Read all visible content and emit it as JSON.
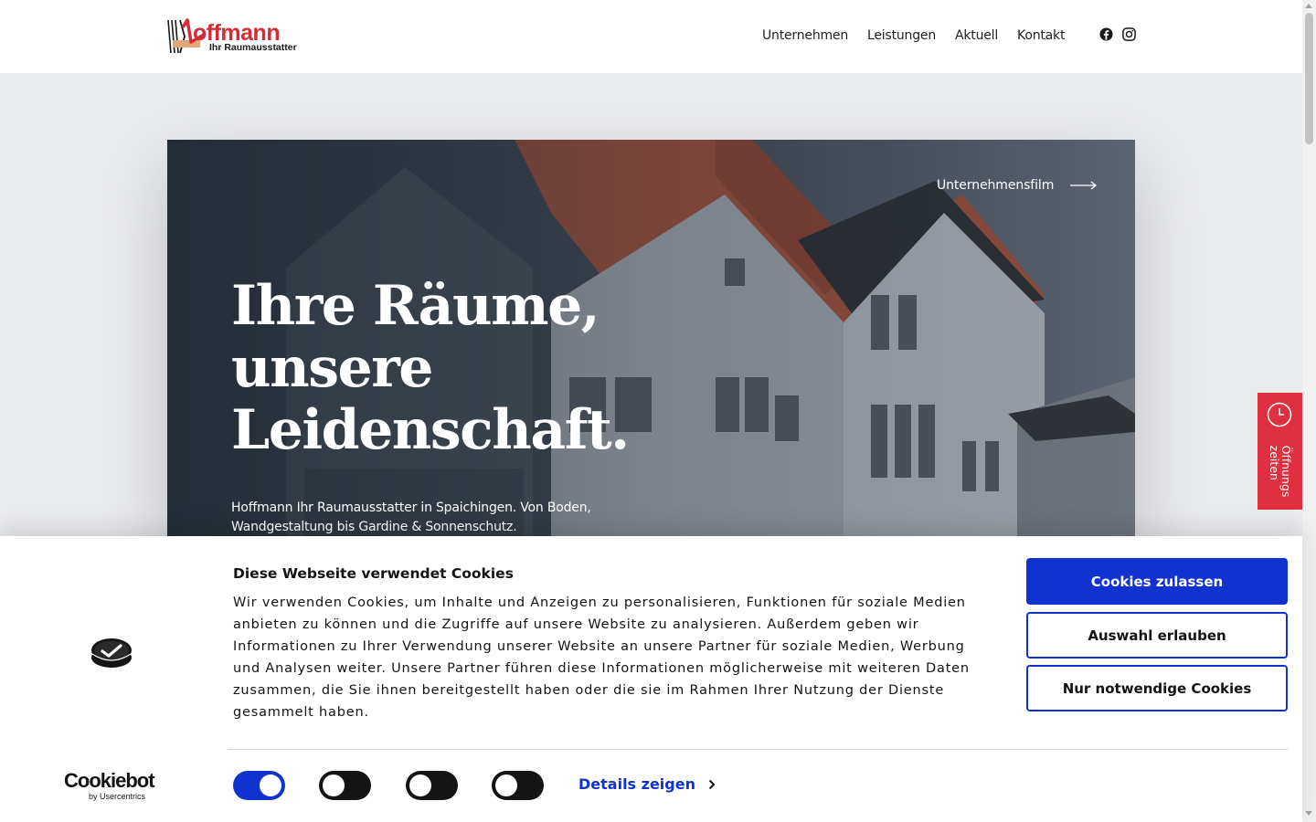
{
  "header": {
    "logo_word": "offmann",
    "logo_sub": "Ihr Raumausstatter",
    "nav": [
      "Unternehmen",
      "Leistungen",
      "Aktuell",
      "Kontakt"
    ],
    "social": [
      "facebook-icon",
      "instagram-icon"
    ]
  },
  "hero": {
    "film_link": "Unternehmensfilm",
    "title_lines": [
      "Ihre Räume,",
      "unsere",
      "Leidenschaft."
    ],
    "description": "Hoffmann Ihr Raumausstatter in Spaichingen. Von Boden, Wandgestaltung bis Gardine & Sonnenschutz."
  },
  "hours_tab": {
    "label_line1": "Öffnungs",
    "label_line2": "zeiten",
    "icon": "clock-icon"
  },
  "cookie_banner": {
    "title": "Diese Webseite verwendet Cookies",
    "text": "Wir verwenden Cookies, um Inhalte und Anzeigen zu personalisieren, Funktionen für soziale Medien anbieten zu können und die Zugriffe auf unsere Website zu analysieren. Außerdem geben wir Informationen zu Ihrer Verwendung unserer Website an unsere Partner für soziale Medien, Werbung und Analysen weiter. Unsere Partner führen diese Informationen möglicherweise mit weiteren Daten zusammen, die Sie ihnen bereitgestellt haben oder die sie im Rahmen Ihrer Nutzung der Dienste gesammelt haben.",
    "btn_allow_all": "Cookies zulassen",
    "btn_allow_selection": "Auswahl erlauben",
    "btn_necessary": "Nur notwendige Cookies",
    "details_label": "Details zeigen",
    "toggles": [
      true,
      false,
      false,
      false
    ],
    "brand_main": "Cookiebot",
    "brand_sub": "by Usercentrics",
    "accent_color": "#1032cf"
  },
  "colors": {
    "brand_red": "#d62b34",
    "hours_tab_red": "#e0303f"
  }
}
